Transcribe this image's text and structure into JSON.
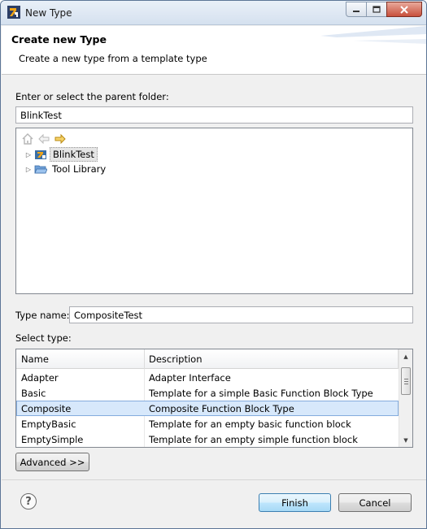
{
  "window": {
    "title": "New Type"
  },
  "banner": {
    "title": "Create new Type",
    "description": "Create a new type from a template type"
  },
  "folder": {
    "label": "Enter or select the parent folder:",
    "value": "BlinkTest"
  },
  "tree": {
    "toolbar": [
      "home-icon",
      "back-arrow-icon",
      "forward-arrow-icon"
    ],
    "items": [
      {
        "label": "BlinkTest",
        "icon": "project-icon",
        "selected": true
      },
      {
        "label": "Tool Library",
        "icon": "open-folder-icon",
        "selected": false
      }
    ]
  },
  "type_name": {
    "label": "Type name:",
    "value": "CompositeTest"
  },
  "select_type": {
    "label": "Select type:",
    "columns": [
      "Name",
      "Description"
    ],
    "rows": [
      {
        "name": "Adapter",
        "description": "Adapter Interface"
      },
      {
        "name": "Basic",
        "description": "Template for a simple Basic Function Block Type"
      },
      {
        "name": "Composite",
        "description": "Composite Function Block Type",
        "selected": true
      },
      {
        "name": "EmptyBasic",
        "description": "Template for an empty basic function block"
      },
      {
        "name": "EmptySimple",
        "description": "Template for an empty simple function block"
      }
    ]
  },
  "buttons": {
    "advanced": "Advanced >>",
    "finish": "Finish",
    "cancel": "Cancel"
  },
  "colors": {
    "selection": "#d7e8fb",
    "titlebar": "#dbe6f3",
    "close_button": "#c8503c"
  }
}
